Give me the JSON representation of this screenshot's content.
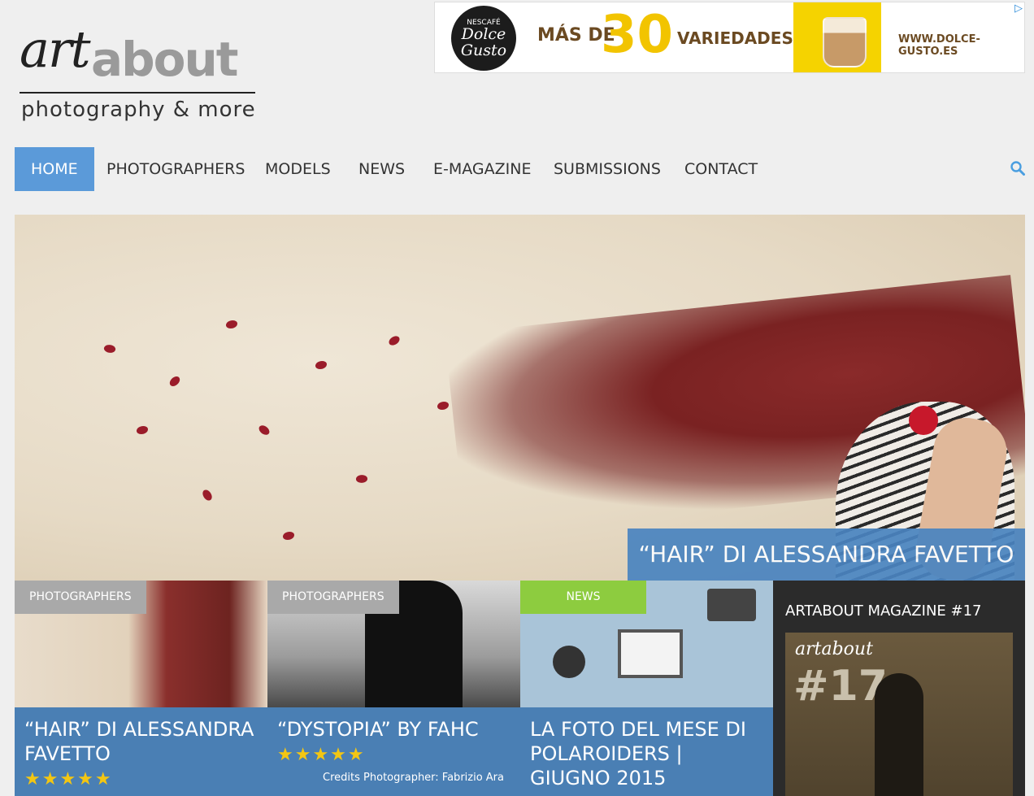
{
  "logo": {
    "word1": "art",
    "word2": "about",
    "tagline": "photography & more"
  },
  "ad": {
    "brand_top": "NESCAFÉ",
    "brand_main": "Dolce Gusto",
    "headline_left": "MÁS DE",
    "headline_number": "30",
    "headline_right": "VARIEDADES",
    "url": "WWW.DOLCE-GUSTO.ES"
  },
  "nav": {
    "items": [
      {
        "label": "HOME"
      },
      {
        "label": "PHOTOGRAPHERS"
      },
      {
        "label": "MODELS"
      },
      {
        "label": "NEWS"
      },
      {
        "label": "E-MAGAZINE"
      },
      {
        "label": "SUBMISSIONS"
      },
      {
        "label": "CONTACT"
      }
    ],
    "active": "HOME",
    "search_icon": "search-icon"
  },
  "hero": {
    "caption": "“HAIR” DI ALESSANDRA FAVETTO"
  },
  "cards": [
    {
      "category": "PHOTOGRAPHERS",
      "title": "“HAIR” DI ALESSANDRA FAVETTO",
      "stars": "★★★★★",
      "rating": 5
    },
    {
      "category": "PHOTOGRAPHERS",
      "title": "“DYSTOPIA” BY FAHC",
      "stars": "★★★★★",
      "rating": 4.5,
      "excerpt": "Credits Photographer: Fabrizio Ara"
    },
    {
      "category": "NEWS",
      "title": "LA FOTO DEL MESE DI POLAROIDERS | GIUGNO 2015"
    }
  ],
  "magazine": {
    "heading": "ARTABOUT MAGAZINE #17",
    "cover_logo": "artabout",
    "cover_number": "#17"
  },
  "colors": {
    "nav_active": "#5b9ad9",
    "card_body": "#4a7fb4",
    "stars": "#f3c613",
    "news_badge": "#8dcc3f"
  }
}
